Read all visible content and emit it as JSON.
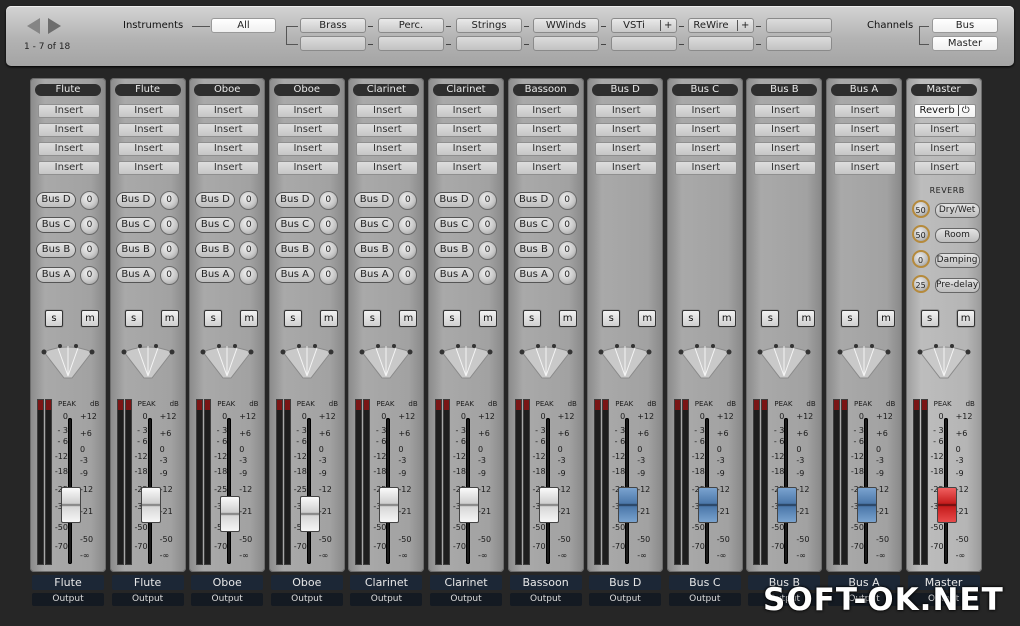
{
  "nav": {
    "counter": "1 - 7 of 18"
  },
  "instruments_label": "Instruments",
  "channels_label": "Channels",
  "filters": {
    "all": "All",
    "row1": [
      "Brass",
      "Perc.",
      "Strings",
      "WWinds",
      "VSTi",
      "ReWire",
      ""
    ],
    "plus": "+"
  },
  "channel_buttons": [
    "Bus",
    "Master"
  ],
  "insert_label": "Insert",
  "solo_label": "s",
  "mute_label": "m",
  "peak_label": "PEAK",
  "db_label": "dB",
  "left_scale": [
    "0",
    "- 3",
    "- 6",
    "-12",
    "-18",
    "-25",
    "-35",
    "-50",
    "-70"
  ],
  "right_scale": [
    "+12",
    "+6",
    "0",
    "-3",
    "-9",
    "-12",
    "-21",
    "-50",
    "-∞"
  ],
  "output_label": "Output",
  "send_names": [
    "Bus D",
    "Bus C",
    "Bus B",
    "Bus A"
  ],
  "send_value": "0",
  "channels": [
    {
      "header": "Flute",
      "name": "Flute",
      "has_sends": true,
      "fader_level": 0.38,
      "fader_color": "silver"
    },
    {
      "header": "Flute",
      "name": "Flute",
      "has_sends": true,
      "fader_level": 0.38,
      "fader_color": "silver"
    },
    {
      "header": "Oboe",
      "name": "Oboe",
      "has_sends": true,
      "fader_level": 0.3,
      "fader_color": "silver"
    },
    {
      "header": "Oboe",
      "name": "Oboe",
      "has_sends": true,
      "fader_level": 0.3,
      "fader_color": "silver"
    },
    {
      "header": "Clarinet",
      "name": "Clarinet",
      "has_sends": true,
      "fader_level": 0.38,
      "fader_color": "silver"
    },
    {
      "header": "Clarinet",
      "name": "Clarinet",
      "has_sends": true,
      "fader_level": 0.38,
      "fader_color": "silver"
    },
    {
      "header": "Bassoon",
      "name": "Bassoon",
      "has_sends": true,
      "fader_level": 0.38,
      "fader_color": "silver"
    },
    {
      "header": "Bus D",
      "name": "Bus D",
      "has_sends": false,
      "fader_level": 0.38,
      "fader_color": "blue"
    },
    {
      "header": "Bus C",
      "name": "Bus C",
      "has_sends": false,
      "fader_level": 0.38,
      "fader_color": "blue"
    },
    {
      "header": "Bus B",
      "name": "Bus B",
      "has_sends": false,
      "fader_level": 0.38,
      "fader_color": "blue"
    },
    {
      "header": "Bus A",
      "name": "Bus A",
      "has_sends": false,
      "fader_level": 0.38,
      "fader_color": "blue"
    },
    {
      "header": "Master",
      "name": "Master",
      "has_sends": false,
      "fader_level": 0.38,
      "fader_color": "red",
      "master": true
    }
  ],
  "master_insert": {
    "label": "Reverb",
    "power": "⏻"
  },
  "reverb": {
    "title": "REVERB",
    "params": [
      {
        "value": "50",
        "label": "Dry/Wet"
      },
      {
        "value": "50",
        "label": "Room"
      },
      {
        "value": "0",
        "label": "Damping"
      },
      {
        "value": "25",
        "label": "Pre-delay"
      }
    ]
  },
  "watermark": "SOFT-OK.NET",
  "colors": {
    "fader_blue": "#4c78aa",
    "fader_red": "#c61d1d",
    "name_bar": "#1c2736"
  }
}
